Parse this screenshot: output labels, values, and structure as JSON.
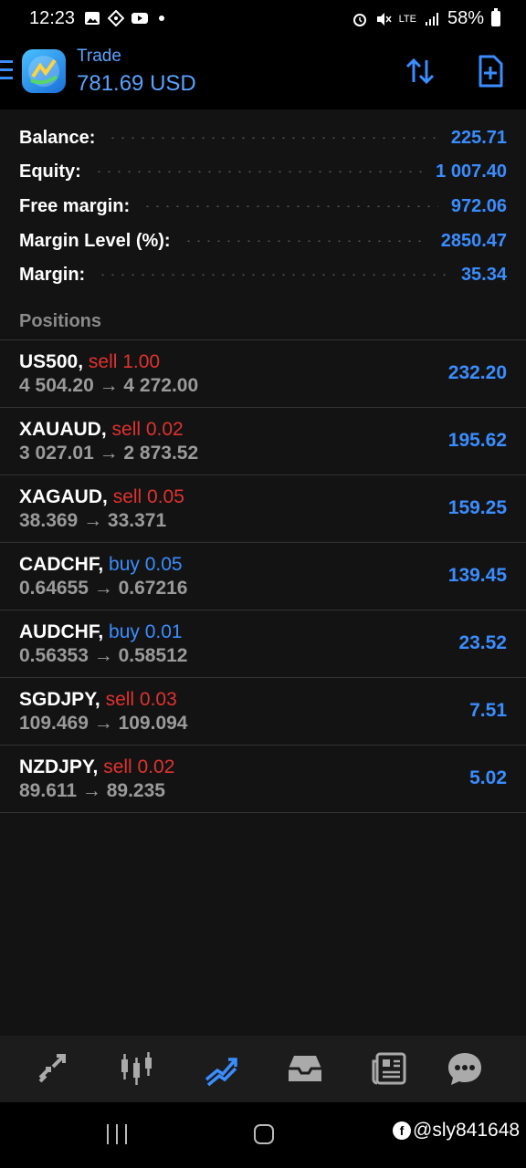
{
  "status_bar": {
    "time": "12:23",
    "network": "LTE",
    "battery": "58%"
  },
  "header": {
    "title": "Trade",
    "balance": "781.69 USD"
  },
  "summary": [
    {
      "label": "Balance:",
      "value": "225.71"
    },
    {
      "label": "Equity:",
      "value": "1 007.40"
    },
    {
      "label": "Free margin:",
      "value": "972.06"
    },
    {
      "label": "Margin Level (%):",
      "value": "2850.47"
    },
    {
      "label": "Margin:",
      "value": "35.34"
    }
  ],
  "positions_title": "Positions",
  "positions": [
    {
      "symbol": "US500,",
      "side": "sell 1.00",
      "prices": "4 504.20 → 4 272.00",
      "profit": "232.20"
    },
    {
      "symbol": "XAUAUD,",
      "side": "sell 0.02",
      "prices": "3 027.01 → 2 873.52",
      "profit": "195.62"
    },
    {
      "symbol": "XAGAUD,",
      "side": "sell 0.05",
      "prices": "38.369 → 33.371",
      "profit": "159.25"
    },
    {
      "symbol": "CADCHF,",
      "side": "buy 0.05",
      "prices": "0.64655 → 0.67216",
      "profit": "139.45"
    },
    {
      "symbol": "AUDCHF,",
      "side": "buy 0.01",
      "prices": "0.56353 → 0.58512",
      "profit": "23.52"
    },
    {
      "symbol": "SGDJPY,",
      "side": "sell 0.03",
      "prices": "109.469 → 109.094",
      "profit": "7.51"
    },
    {
      "symbol": "NZDJPY,",
      "side": "sell 0.02",
      "prices": "89.611 → 89.235",
      "profit": "5.02"
    }
  ],
  "bottom_nav": [
    {
      "icon": "quotes-icon",
      "active": false
    },
    {
      "icon": "chart-icon",
      "active": false
    },
    {
      "icon": "trade-icon",
      "active": true
    },
    {
      "icon": "history-icon",
      "active": false
    },
    {
      "icon": "news-icon",
      "active": false
    },
    {
      "icon": "messages-icon",
      "active": false
    }
  ],
  "watermark": "@sly841648",
  "colors": {
    "accent": "#3a8dff",
    "sell": "#e0322e",
    "background": "#131313"
  }
}
